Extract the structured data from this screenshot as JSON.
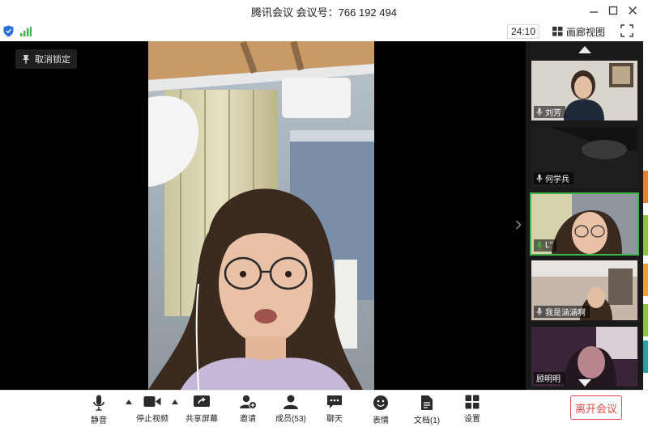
{
  "window": {
    "title": "腾讯会议 会议号：766 192 494"
  },
  "toolbar": {
    "timer": "24:10",
    "gallery_view_label": "画廊视图"
  },
  "stage": {
    "unlock_label": "取消锁定"
  },
  "participants": [
    {
      "name": "刘芳",
      "mic": "muted-gray",
      "active": false
    },
    {
      "name": "何学兵",
      "mic": "muted-gray",
      "active": false
    },
    {
      "name": "L''",
      "mic": "speaking",
      "active": true
    },
    {
      "name": "我是涵涵啊",
      "mic": "muted-gray",
      "active": false
    },
    {
      "name": "顾明明",
      "mic": "none",
      "active": false
    }
  ],
  "bottom_tools": [
    {
      "label": "静音",
      "icon": "microphone-icon"
    },
    {
      "label": "停止视频",
      "icon": "video-camera-icon"
    },
    {
      "label": "共享屏幕",
      "icon": "share-screen-icon"
    },
    {
      "label": "邀请",
      "icon": "invite-icon"
    },
    {
      "label": "成员(53)",
      "icon": "members-icon"
    },
    {
      "label": "聊天",
      "icon": "chat-icon"
    },
    {
      "label": "表情",
      "icon": "emoji-icon"
    },
    {
      "label": "文档(1)",
      "icon": "document-icon"
    },
    {
      "label": "设置",
      "icon": "settings-icon"
    }
  ],
  "leave_button": {
    "label": "离开会议"
  },
  "colors": {
    "accent_green": "#3db848",
    "leave_red": "#e04848",
    "shield_blue": "#2a6fdb",
    "stage_black": "#000000"
  }
}
